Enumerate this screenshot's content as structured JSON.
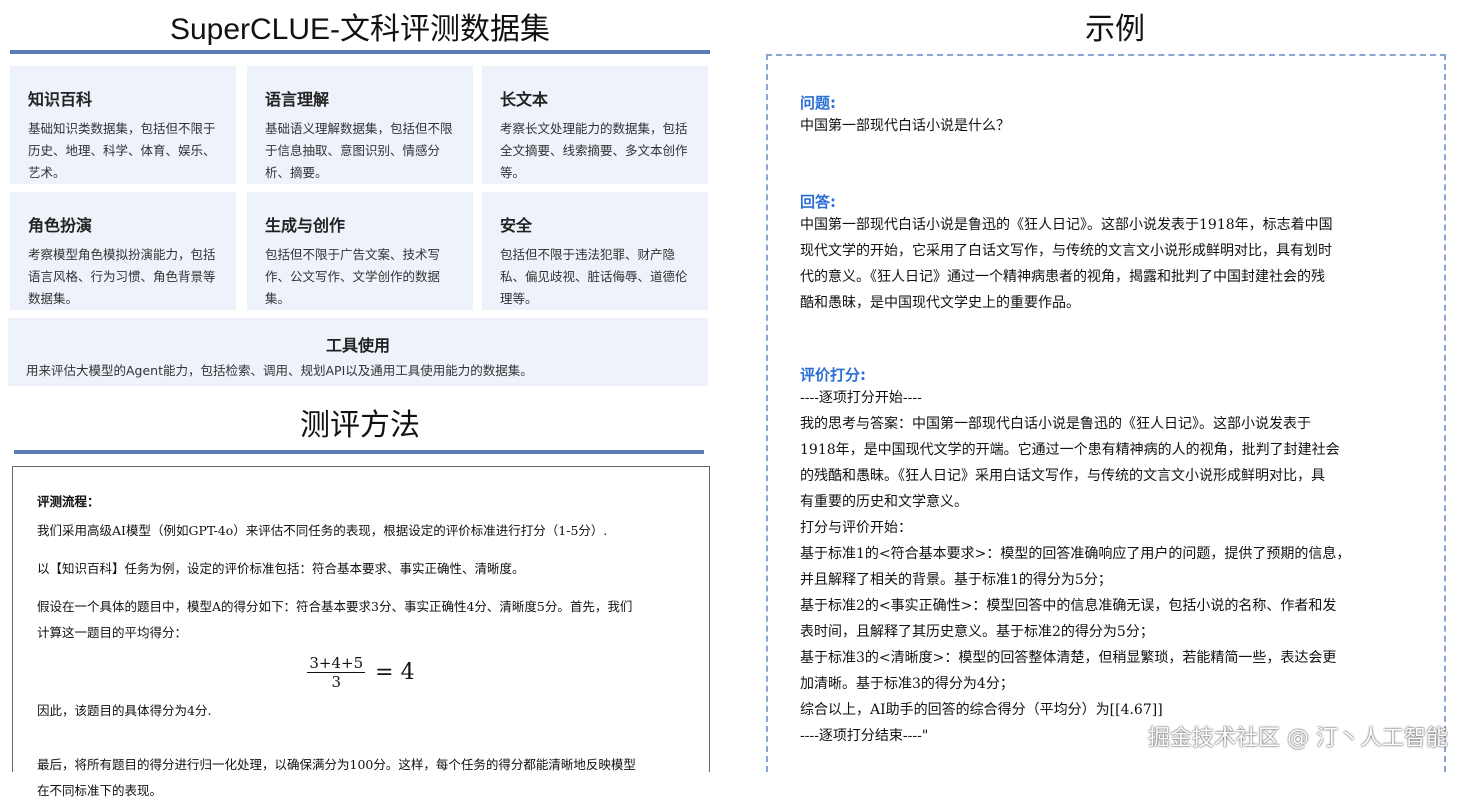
{
  "left": {
    "title": "SuperCLUE-文科评测数据集",
    "cards": [
      {
        "title": "知识百科",
        "desc": "基础知识类数据集，包括但不限于历史、地理、科学、体育、娱乐、艺术。"
      },
      {
        "title": "语言理解",
        "desc": "基础语义理解数据集，包括但不限于信息抽取、意图识别、情感分析、摘要。"
      },
      {
        "title": "长文本",
        "desc": "考察长文处理能力的数据集，包括全文摘要、线索摘要、多文本创作等。"
      },
      {
        "title": "角色扮演",
        "desc": "考察模型角色模拟扮演能力，包括语言风格、行为习惯、角色背景等数据集。"
      },
      {
        "title": "生成与创作",
        "desc": "包括但不限于广告文案、技术写作、公文写作、文学创作的数据集。"
      },
      {
        "title": "安全",
        "desc": "包括但不限于违法犯罪、财产隐私、偏见歧视、脏话侮辱、道德伦理等。"
      },
      {
        "title": "工具使用",
        "desc": "用来评估大模型的Agent能力，包括检索、调用、规划API以及通用工具使用能力的数据集。"
      }
    ],
    "method_title": "测评方法",
    "method": {
      "label": "评测流程：",
      "p1": "我们采用高级AI模型（例如GPT-4o）来评估不同任务的表现，根据设定的评价标准进行打分（1-5分）.",
      "p2": "以【知识百科】任务为例，设定的评价标准包括：符合基本要求、事实正确性、清晰度。",
      "p3a": "假设在一个具体的题目中，模型A的得分如下：符合基本要求3分、事实正确性4分、清晰度5分。首先，我们",
      "p3b": "计算这一题目的平均得分：",
      "formula_num": "3+4+5",
      "formula_den": "3",
      "formula_rhs": "= 4",
      "p4": "因此，该题目的具体得分为4分.",
      "p5a": "最后，将所有题目的得分进行归一化处理，以确保满分为100分。这样，每个任务的得分都能清晰地反映模型",
      "p5b": "在不同标准下的表现。"
    }
  },
  "right": {
    "title": "示例",
    "q_label": "问题:",
    "q_text": "中国第一部现代白话小说是什么？",
    "a_label": "回答:",
    "a_lines": [
      "中国第一部现代白话小说是鲁迅的《狂人日记》。这部小说发表于1918年，标志着中国",
      "现代文学的开始，它采用了白话文写作，与传统的文言文小说形成鲜明对比，具有划时",
      "代的意义。《狂人日记》通过一个精神病患者的视角，揭露和批判了中国封建社会的残",
      "酷和愚昧，是中国现代文学史上的重要作品。"
    ],
    "s_label": "评价打分:",
    "s_lines": [
      "----逐项打分开始----",
      "我的思考与答案：中国第一部现代白话小说是鲁迅的《狂人日记》。这部小说发表于",
      "1918年，是中国现代文学的开端。它通过一个患有精神病的人的视角，批判了封建社会",
      "的残酷和愚昧。《狂人日记》采用白话文写作，与传统的文言文小说形成鲜明对比，具",
      "有重要的历史和文学意义。",
      "打分与评价开始：",
      "基于标准1的<符合基本要求>：模型的回答准确响应了用户的问题，提供了预期的信息，",
      "并且解释了相关的背景。基于标准1的得分为5分；",
      "基于标准2的<事实正确性>：模型回答中的信息准确无误，包括小说的名称、作者和发",
      "表时间，且解释了其历史意义。基于标准2的得分为5分；",
      "基于标准3的<清晰度>：模型的回答整体清楚，但稍显繁琐，若能精简一些，表达会更",
      "加清晰。基于标准3的得分为4分；",
      "综合以上，AI助手的回答的综合得分（平均分）为[[4.67]]",
      "----逐项打分结束----\""
    ],
    "watermark": "掘金技术社区 @ 汀丶人工智能"
  }
}
